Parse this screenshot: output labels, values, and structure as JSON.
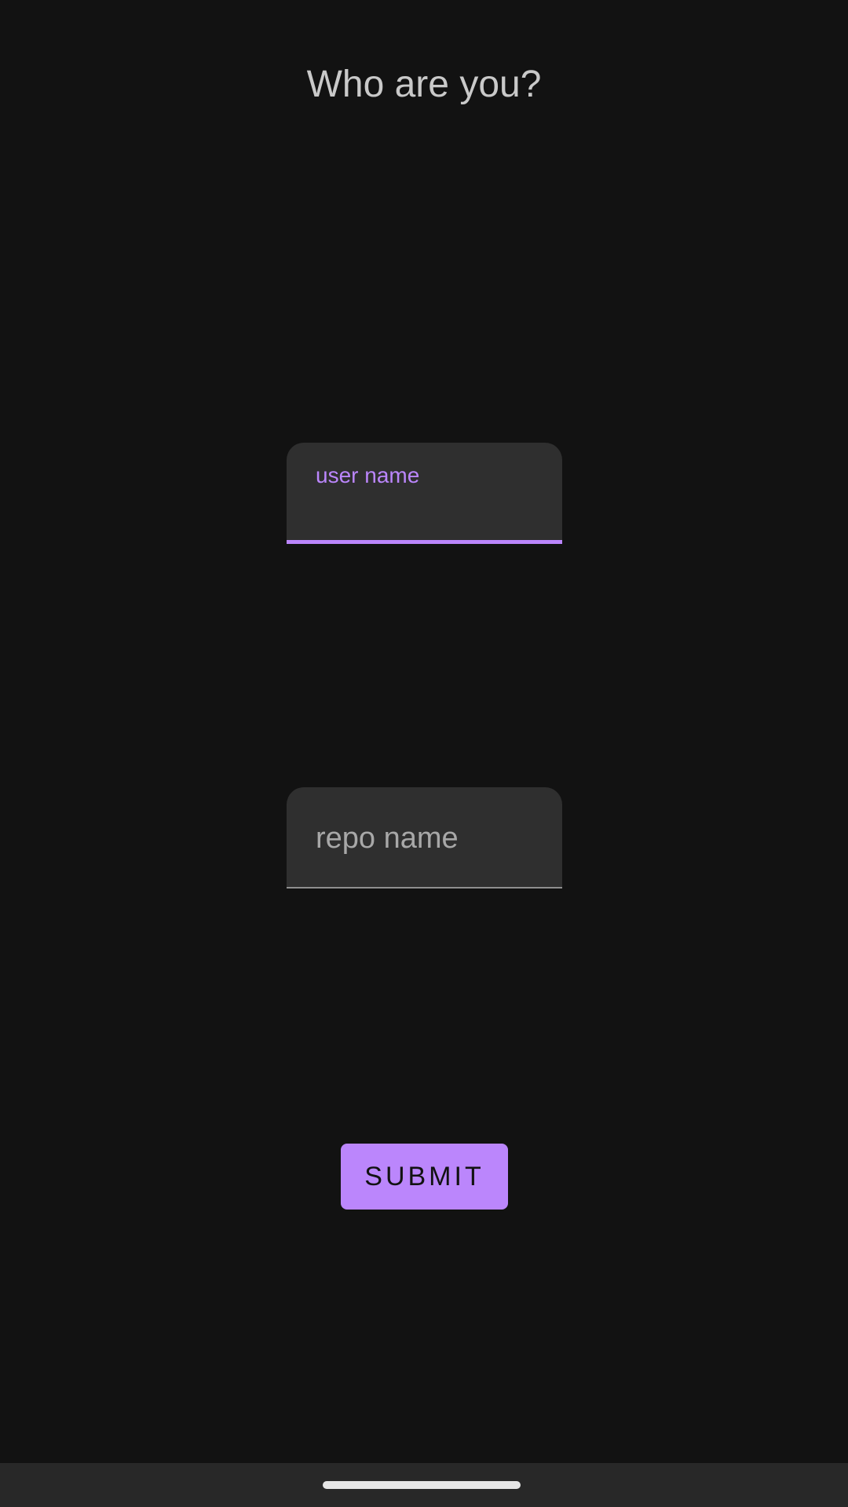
{
  "screen": {
    "title": "Who are you?"
  },
  "form": {
    "user_field": {
      "label": "user name",
      "value": "",
      "state": "focused"
    },
    "repo_field": {
      "placeholder": "repo name",
      "value": "",
      "state": "idle"
    },
    "submit_label": "SUBMIT"
  },
  "colors": {
    "background": "#121212",
    "field_fill": "#2f2f2f",
    "accent": "#bb86fc",
    "title_text": "#c9c9c9",
    "nav_bar": "#282828"
  },
  "system": {
    "nav_handle_icon": "home-gesture-handle"
  }
}
